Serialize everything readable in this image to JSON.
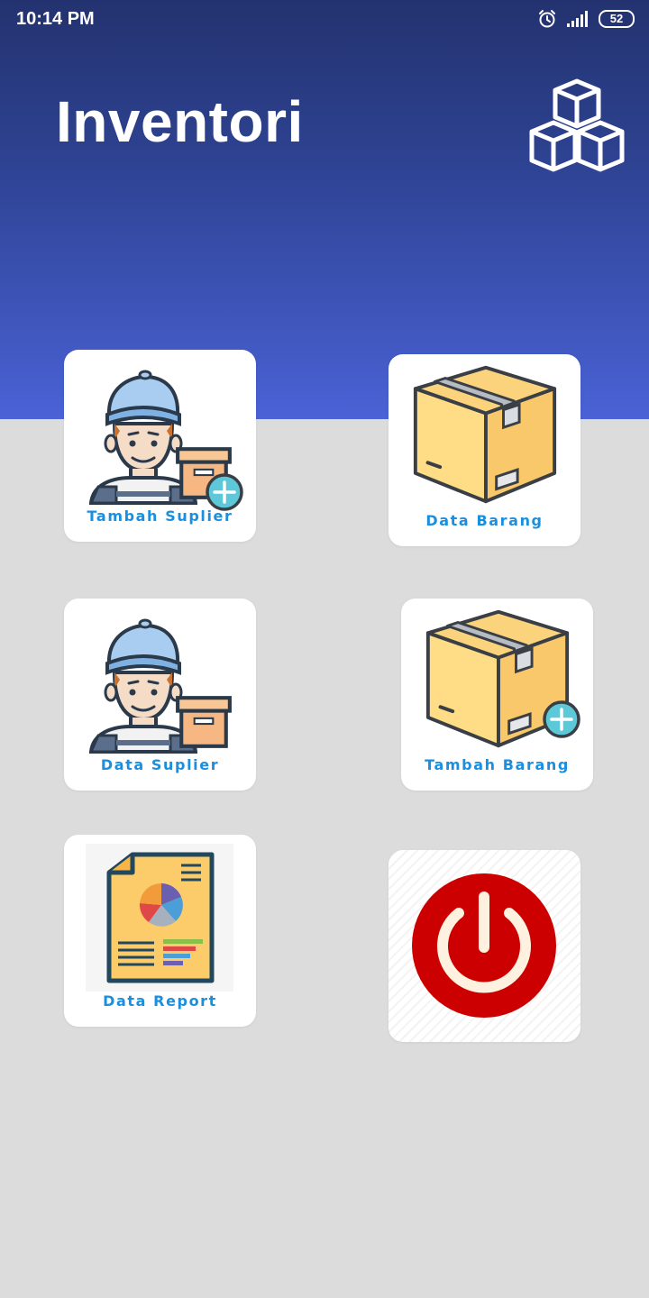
{
  "status_bar": {
    "time": "10:14 PM",
    "battery": "52"
  },
  "header": {
    "title": "Inventori",
    "logo_icon": "boxes-icon"
  },
  "menu": {
    "tambah_suplier": {
      "label": "Tambah Suplier",
      "icon": "supplier-add-icon"
    },
    "data_barang": {
      "label": "Data Barang",
      "icon": "box-icon"
    },
    "data_suplier": {
      "label": "Data Suplier",
      "icon": "supplier-icon"
    },
    "tambah_barang": {
      "label": "Tambah Barang",
      "icon": "box-add-icon"
    },
    "data_report": {
      "label": "Data Report",
      "icon": "report-icon"
    },
    "power": {
      "icon": "power-icon"
    }
  },
  "colors": {
    "header_top": "#23326f",
    "header_bottom": "#4a62d6",
    "background": "#dcdcdc",
    "label": "#1a8fe0",
    "power_red": "#cc0000"
  }
}
